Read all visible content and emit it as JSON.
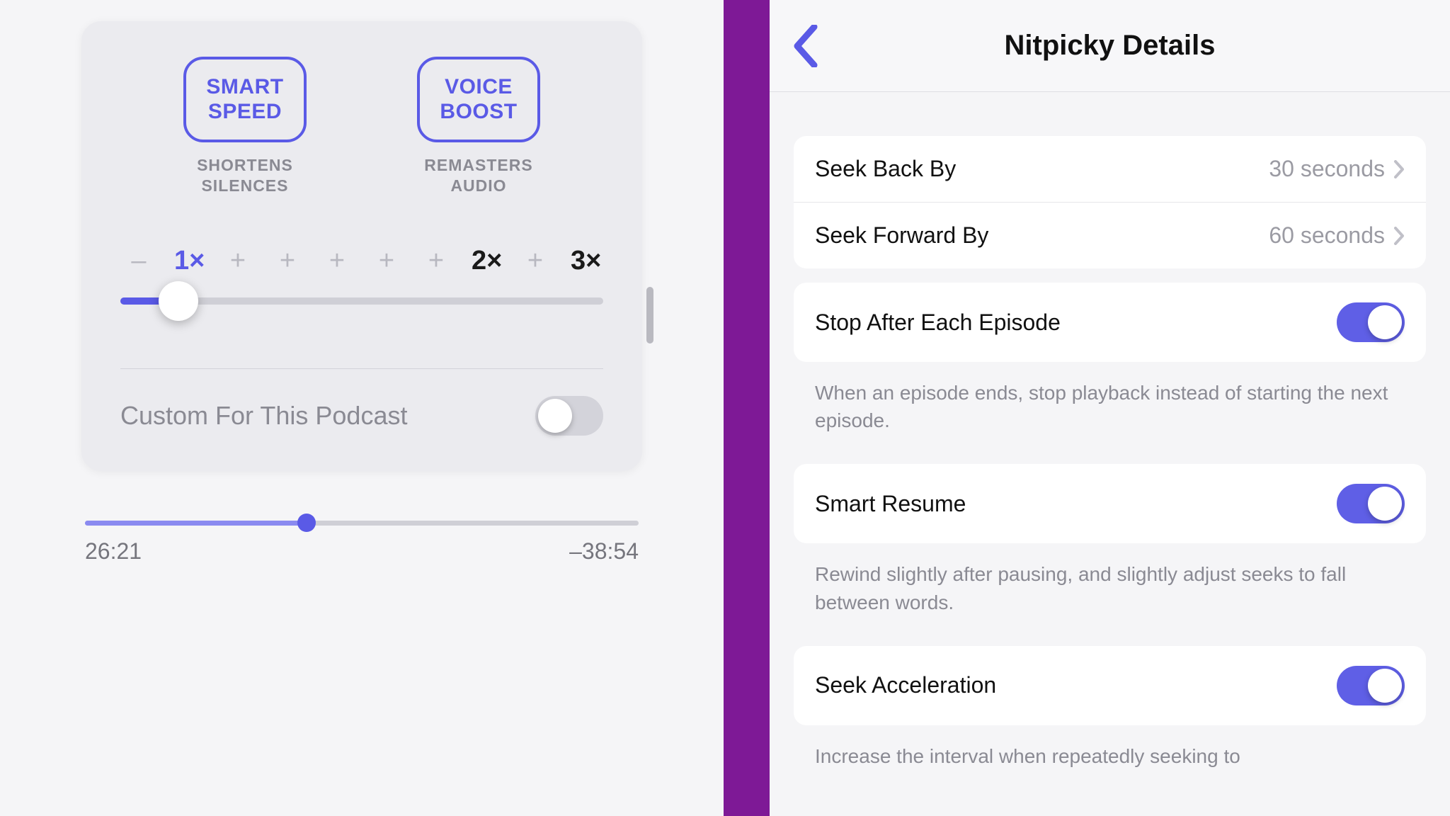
{
  "left": {
    "smart_speed": {
      "button": "SMART\nSPEED",
      "subtitle": "SHORTENS\nSILENCES"
    },
    "voice_boost": {
      "button": "VOICE\nBOOST",
      "subtitle": "REMASTERS\nAUDIO"
    },
    "speed": {
      "ticks": [
        "–",
        "1×",
        "+",
        "+",
        "+",
        "+",
        "+",
        "2×",
        "+",
        "3×"
      ],
      "current_index": 1,
      "fill_pct": 12,
      "thumb_pct": 12
    },
    "custom_label": "Custom For This Podcast",
    "custom_on": false,
    "progress": {
      "elapsed": "26:21",
      "remaining": "–38:54",
      "pct": 40
    }
  },
  "right": {
    "title": "Nitpicky Details",
    "seek_back": {
      "label": "Seek Back By",
      "value": "30 seconds"
    },
    "seek_forward": {
      "label": "Seek Forward By",
      "value": "60 seconds"
    },
    "stop_each": {
      "label": "Stop After Each Episode",
      "on": true,
      "desc": "When an episode ends, stop playback instead of starting the next episode."
    },
    "smart_resume": {
      "label": "Smart Resume",
      "on": true,
      "desc": "Rewind slightly after pausing, and slightly adjust seeks to fall between words."
    },
    "seek_accel": {
      "label": "Seek Acceleration",
      "on": true,
      "desc": "Increase the interval when repeatedly seeking to"
    }
  },
  "colors": {
    "accent": "#5a5ae6",
    "purple_bg": "#7e1996",
    "cyan": "#11a9e6"
  }
}
